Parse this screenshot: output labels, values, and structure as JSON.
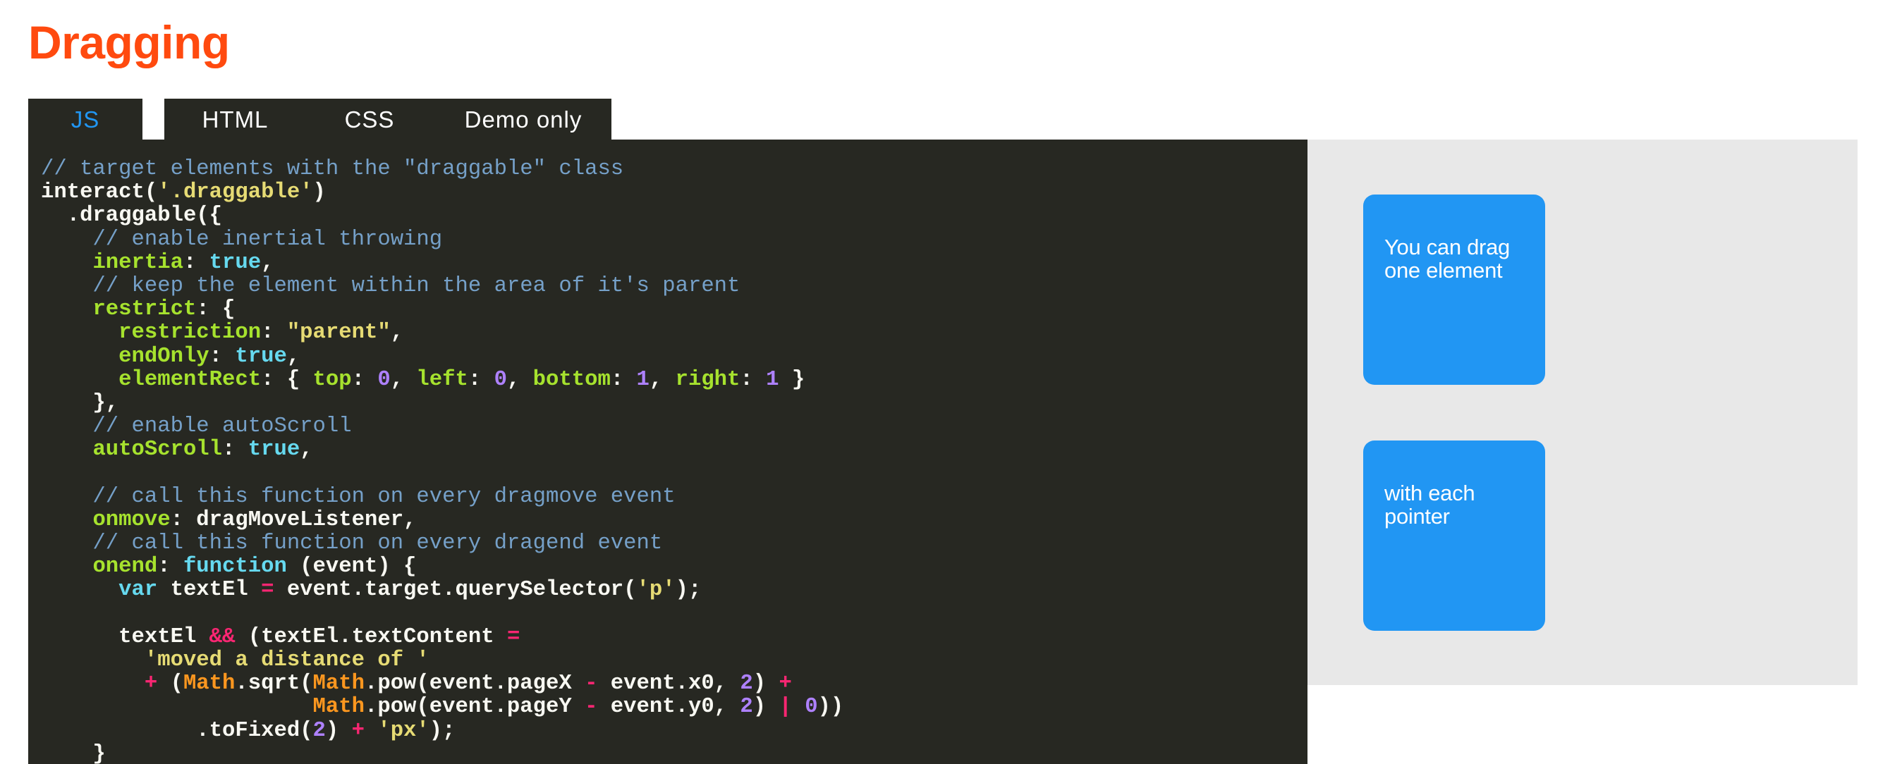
{
  "page": {
    "title": "Dragging"
  },
  "tabs": [
    {
      "label": "JS",
      "active": true
    },
    {
      "label": "HTML",
      "active": false
    },
    {
      "label": "CSS",
      "active": false
    },
    {
      "label": "Demo only",
      "active": false
    }
  ],
  "code": {
    "lines": [
      [
        [
          "c-comment",
          "// target elements with the \"draggable\" class"
        ]
      ],
      [
        [
          "c-plain",
          "interact("
        ],
        [
          "c-str",
          "'.draggable'"
        ],
        [
          "c-plain",
          ")"
        ]
      ],
      [
        [
          "c-plain",
          "  .draggable({"
        ]
      ],
      [
        [
          "c-comment",
          "    // enable inertial throwing"
        ]
      ],
      [
        [
          "c-plain",
          "    "
        ],
        [
          "c-prop",
          "inertia"
        ],
        [
          "c-plain",
          ": "
        ],
        [
          "c-bool",
          "true"
        ],
        [
          "c-plain",
          ","
        ]
      ],
      [
        [
          "c-comment",
          "    // keep the element within the area of it's parent"
        ]
      ],
      [
        [
          "c-plain",
          "    "
        ],
        [
          "c-prop",
          "restrict"
        ],
        [
          "c-plain",
          ": {"
        ]
      ],
      [
        [
          "c-plain",
          "      "
        ],
        [
          "c-prop",
          "restriction"
        ],
        [
          "c-plain",
          ": "
        ],
        [
          "c-str",
          "\"parent\""
        ],
        [
          "c-plain",
          ","
        ]
      ],
      [
        [
          "c-plain",
          "      "
        ],
        [
          "c-prop",
          "endOnly"
        ],
        [
          "c-plain",
          ": "
        ],
        [
          "c-bool",
          "true"
        ],
        [
          "c-plain",
          ","
        ]
      ],
      [
        [
          "c-plain",
          "      "
        ],
        [
          "c-prop",
          "elementRect"
        ],
        [
          "c-plain",
          ": { "
        ],
        [
          "c-prop",
          "top"
        ],
        [
          "c-plain",
          ": "
        ],
        [
          "c-num",
          "0"
        ],
        [
          "c-plain",
          ", "
        ],
        [
          "c-prop",
          "left"
        ],
        [
          "c-plain",
          ": "
        ],
        [
          "c-num",
          "0"
        ],
        [
          "c-plain",
          ", "
        ],
        [
          "c-prop",
          "bottom"
        ],
        [
          "c-plain",
          ": "
        ],
        [
          "c-num",
          "1"
        ],
        [
          "c-plain",
          ", "
        ],
        [
          "c-prop",
          "right"
        ],
        [
          "c-plain",
          ": "
        ],
        [
          "c-num",
          "1"
        ],
        [
          "c-plain",
          " }"
        ]
      ],
      [
        [
          "c-plain",
          "    },"
        ]
      ],
      [
        [
          "c-comment",
          "    // enable autoScroll"
        ]
      ],
      [
        [
          "c-plain",
          "    "
        ],
        [
          "c-prop",
          "autoScroll"
        ],
        [
          "c-plain",
          ": "
        ],
        [
          "c-bool",
          "true"
        ],
        [
          "c-plain",
          ","
        ]
      ],
      [
        [
          "c-plain",
          ""
        ]
      ],
      [
        [
          "c-comment",
          "    // call this function on every dragmove event"
        ]
      ],
      [
        [
          "c-plain",
          "    "
        ],
        [
          "c-prop",
          "onmove"
        ],
        [
          "c-plain",
          ": dragMoveListener,"
        ]
      ],
      [
        [
          "c-comment",
          "    // call this function on every dragend event"
        ]
      ],
      [
        [
          "c-plain",
          "    "
        ],
        [
          "c-prop",
          "onend"
        ],
        [
          "c-plain",
          ": "
        ],
        [
          "c-kw",
          "function"
        ],
        [
          "c-plain",
          " (event) {"
        ]
      ],
      [
        [
          "c-plain",
          "      "
        ],
        [
          "c-kw",
          "var"
        ],
        [
          "c-plain",
          " textEl "
        ],
        [
          "c-op",
          "="
        ],
        [
          "c-plain",
          " event.target.querySelector("
        ],
        [
          "c-str",
          "'p'"
        ],
        [
          "c-plain",
          ");"
        ]
      ],
      [
        [
          "c-plain",
          ""
        ]
      ],
      [
        [
          "c-plain",
          "      textEl "
        ],
        [
          "c-op",
          "&&"
        ],
        [
          "c-plain",
          " (textEl.textContent "
        ],
        [
          "c-op",
          "="
        ]
      ],
      [
        [
          "c-plain",
          "        "
        ],
        [
          "c-str",
          "'moved a distance of '"
        ]
      ],
      [
        [
          "c-plain",
          "        "
        ],
        [
          "c-op",
          "+"
        ],
        [
          "c-plain",
          " ("
        ],
        [
          "c-builtin",
          "Math"
        ],
        [
          "c-plain",
          ".sqrt("
        ],
        [
          "c-builtin",
          "Math"
        ],
        [
          "c-plain",
          ".pow(event.pageX "
        ],
        [
          "c-op",
          "-"
        ],
        [
          "c-plain",
          " event.x0, "
        ],
        [
          "c-num",
          "2"
        ],
        [
          "c-plain",
          ") "
        ],
        [
          "c-op",
          "+"
        ]
      ],
      [
        [
          "c-plain",
          "                     "
        ],
        [
          "c-builtin",
          "Math"
        ],
        [
          "c-plain",
          ".pow(event.pageY "
        ],
        [
          "c-op",
          "-"
        ],
        [
          "c-plain",
          " event.y0, "
        ],
        [
          "c-num",
          "2"
        ],
        [
          "c-plain",
          ") "
        ],
        [
          "c-op",
          "|"
        ],
        [
          "c-plain",
          " "
        ],
        [
          "c-num",
          "0"
        ],
        [
          "c-plain",
          "))"
        ]
      ],
      [
        [
          "c-plain",
          "            .toFixed("
        ],
        [
          "c-num",
          "2"
        ],
        [
          "c-plain",
          ") "
        ],
        [
          "c-op",
          "+"
        ],
        [
          "c-plain",
          " "
        ],
        [
          "c-str",
          "'px'"
        ],
        [
          "c-plain",
          ");"
        ]
      ],
      [
        [
          "c-plain",
          "    }"
        ]
      ]
    ]
  },
  "demo": {
    "box1_text": "You can drag one element",
    "box2_text": "with each pointer"
  },
  "colors": {
    "title": "#ff4a0f",
    "accent": "#2196f3",
    "code_bg": "#272822",
    "demo_bg": "#e8e8e8"
  }
}
